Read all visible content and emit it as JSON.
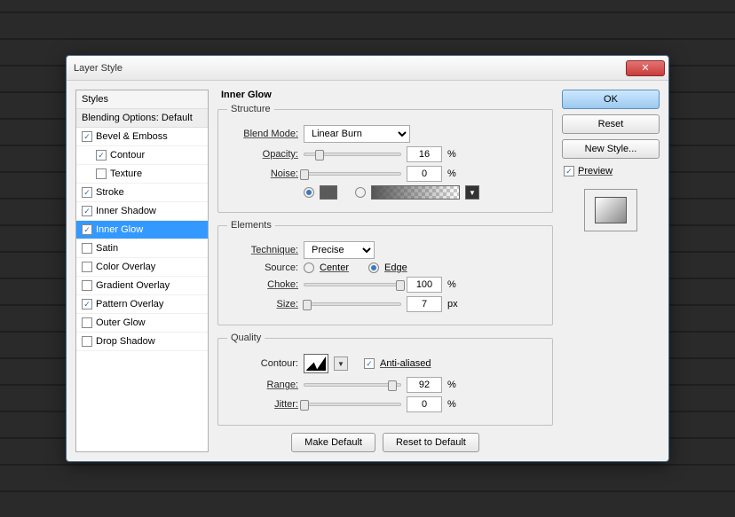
{
  "window": {
    "title": "Layer Style"
  },
  "sidebar": {
    "header": "Styles",
    "blending": "Blending Options: Default",
    "items": [
      {
        "label": "Bevel & Emboss",
        "checked": true
      },
      {
        "label": "Contour",
        "checked": true,
        "indent": true
      },
      {
        "label": "Texture",
        "checked": false,
        "indent": true
      },
      {
        "label": "Stroke",
        "checked": true
      },
      {
        "label": "Inner Shadow",
        "checked": true
      },
      {
        "label": "Inner Glow",
        "checked": true,
        "selected": true
      },
      {
        "label": "Satin",
        "checked": false
      },
      {
        "label": "Color Overlay",
        "checked": false
      },
      {
        "label": "Gradient Overlay",
        "checked": false
      },
      {
        "label": "Pattern Overlay",
        "checked": true
      },
      {
        "label": "Outer Glow",
        "checked": false
      },
      {
        "label": "Drop Shadow",
        "checked": false
      }
    ]
  },
  "panel": {
    "title": "Inner Glow",
    "structure": {
      "legend": "Structure",
      "blendModeLabel": "Blend Mode:",
      "blendMode": "Linear Burn",
      "opacityLabel": "Opacity:",
      "opacity": "16",
      "noiseLabel": "Noise:",
      "noise": "0",
      "percent": "%"
    },
    "elements": {
      "legend": "Elements",
      "techniqueLabel": "Technique:",
      "technique": "Precise",
      "sourceLabel": "Source:",
      "center": "Center",
      "edge": "Edge",
      "chokeLabel": "Choke:",
      "choke": "100",
      "sizeLabel": "Size:",
      "size": "7",
      "px": "px",
      "percent": "%"
    },
    "quality": {
      "legend": "Quality",
      "contourLabel": "Contour:",
      "antiAliased": "Anti-aliased",
      "rangeLabel": "Range:",
      "range": "92",
      "jitterLabel": "Jitter:",
      "jitter": "0",
      "percent": "%"
    },
    "makeDefault": "Make Default",
    "resetDefault": "Reset to Default"
  },
  "right": {
    "ok": "OK",
    "reset": "Reset",
    "newStyle": "New Style...",
    "preview": "Preview"
  }
}
